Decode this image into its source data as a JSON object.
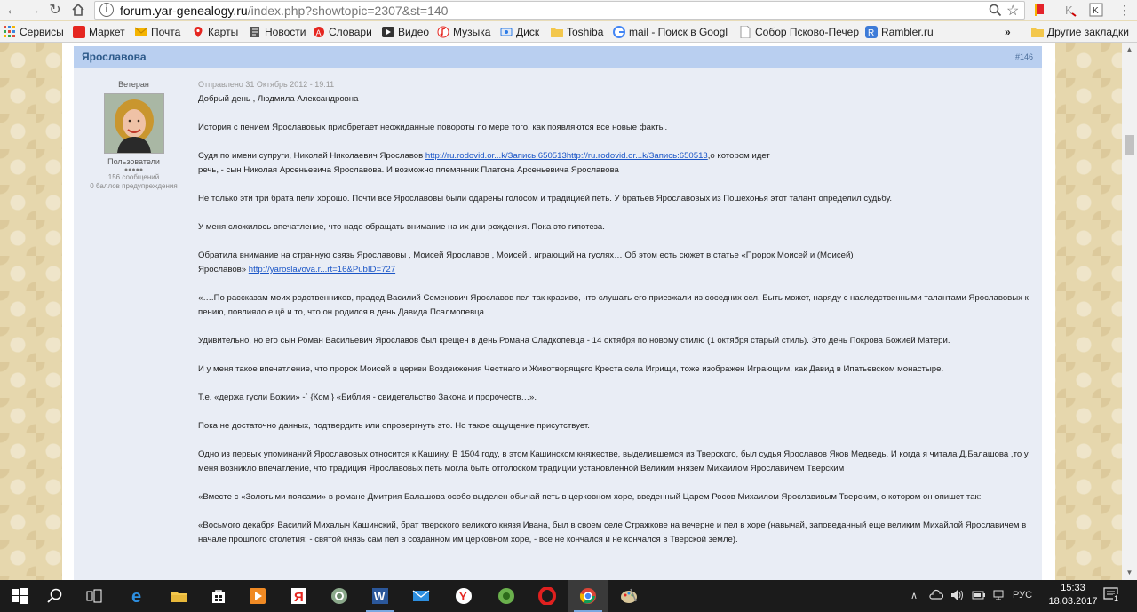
{
  "browser": {
    "url_host": "forum.yar-genealogy.ru",
    "url_rest": "/index.php?showtopic=2307&st=140",
    "bookmarks": [
      {
        "label": "Сервисы",
        "icon": "apps-grid-icon",
        "color": "#e04a3a"
      },
      {
        "label": "Маркет",
        "icon": "market-icon",
        "color": "#e52620"
      },
      {
        "label": "Почта",
        "icon": "mail-envelope-icon",
        "color": "#f5b400"
      },
      {
        "label": "Карты",
        "icon": "map-pin-icon",
        "color": "#e52620"
      },
      {
        "label": "Новости",
        "icon": "news-icon",
        "color": "#555555"
      },
      {
        "label": "Словари",
        "icon": "dictionary-icon",
        "color": "#e52620"
      },
      {
        "label": "Видео",
        "icon": "video-play-icon",
        "color": "#333333"
      },
      {
        "label": "Музыка",
        "icon": "music-note-icon",
        "color": "#e52620"
      },
      {
        "label": "Диск",
        "icon": "disk-icon",
        "color": "#2c7be5"
      },
      {
        "label": "Toshiba",
        "icon": "folder-icon",
        "color": "#f3c74c"
      },
      {
        "label": "mail - Поиск в Googl",
        "icon": "google-g-icon",
        "color": "#4285f4"
      },
      {
        "label": "Собор Псково-Печер",
        "icon": "page-icon",
        "color": "#bbbbbb"
      },
      {
        "label": "Rambler.ru",
        "icon": "rambler-icon",
        "color": "#3d7bd8"
      }
    ],
    "more_bookmarks_label": "»",
    "other_bookmarks": "Другие закладки"
  },
  "post": {
    "author": "Ярославова",
    "number": "#146",
    "user_title": "Ветеран",
    "group": "Пользователи",
    "stars": "●●●●●",
    "posts_count": "156 сообщений",
    "warnings": "0 баллов предупреждения",
    "date": "Отправлено 31 Октябрь 2012 - 19:11",
    "p1": "Добрый  день , Людмила Александровна",
    "p2": "История   с пением  Ярославовых   приобретает  неожиданные повороты   по мере  того, как появляются все новые факты.",
    "p3_a": "Судя  по имени супруги,  Николай Николаевич Ярославов  ",
    "p3_link": "http://ru.rodovid.or...k/Запись:650513http://ru.rodovid.or...k/Запись:650513",
    "p3_b": ",о котором идет",
    "p3_c": "речь,  -  сын  Николая  Арсеньевича  Ярославова.  И  возможно племянник  Платона  Арсеньевича Ярославова",
    "p4": "Не только  эти три брата  пели  хорошо.  Почти все Ярославовы были одарены голосом и  традицией  петь. У братьев Ярославовых  из Пошехонья  этот талант   определил   судьбу.",
    "p5": "У меня  сложилось  впечатление, что   надо  обращать внимание   на их дни рождения.  Пока   это гипотеза.",
    "p6_a": "Обратила  внимание на странную  связь  Ярославовы  ,    Моисей  Ярославов , Моисей    . играющий на гуслях… Об этом  есть  сюжет в статье «Пророк Моисей и (Моисей)",
    "p6_b": "Ярославов»  ",
    "p6_link": "http://yaroslavova.r...rt=16&PubID=727",
    "p7": "«….По рассказам моих родственников, прадед Василий Семенович Ярославов пел так красиво, что слушать его приезжали из соседних сел. Быть может, наряду с наследственными талантами Ярославовых к пению, повлияло ещё и то, что он родился в день Давида Псалмопевца.",
    "p8": "Удивительно, но его сын Роман Васильевич Ярославов был крещен в день Романа Сладкопевца - 14 октября по новому стилю (1 октября старый стиль). Это день Покрова Божией Матери.",
    "p9": "И у меня такое впечатление, что пророк Моисей в церкви Воздвижения Честнаго и Животворящего Креста села Игрищи, тоже изображен Играющим, как Давид в Ипатьевском монастыре.",
    "p10": "Т.е. «держа гусли Божии» -` {Ком.} «Библия - свидетельство Закона и пророчеств…».",
    "p11": "Пока   не  достаточно  данных, подтвердить или опровергнуть это. Но такое ощущение  присутствует.",
    "p12": "Одно  из первых   упоминаний  Ярославовых  относится к  Кашину.   В  1504 году, в этом Кашинском княжестве,  выделившемся из Тверского,   был судья  Ярославов  Яков  Медведь.  И  когда  я читала  Д.Балашова ,то у меня  возникло впечатление, что  традиция  Ярославовых петь   могла   быть отголоском традиции установленной Великим   князем   Михаилом Ярославичем Тверским",
    "p13": "«Вместе с «Золотыми поясами» в романе Дмитрия Балашова особо выделен обычай петь в церковном хоре, введенный Царем Росов Михаилом Ярославивым Тверским, о котором он опишет так:",
    "p14": "«Восьмого декабря Василий Михалыч Кашинский, брат тверского великого князя Ивана, был в своем селе Стражкове на вечерне и пел в хоре (навычай, заповеданный еще великим Михайлой Ярославичем в начале прошлого столетия: - святой князь сам пел в созданном им церковном хоре, - все не кончался и не кончался в Тверской земле)."
  },
  "taskbar": {
    "language": "РУС",
    "time": "15:33",
    "date": "18.03.2017",
    "notification_count": "1"
  }
}
